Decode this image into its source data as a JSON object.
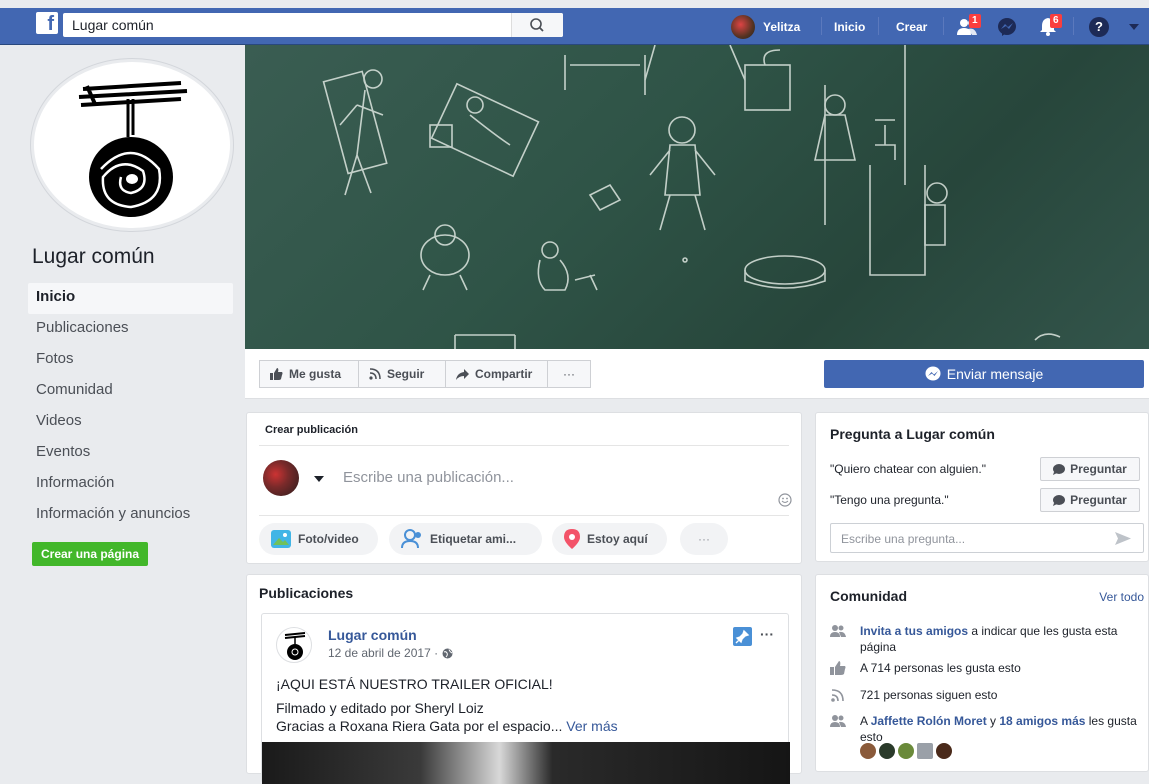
{
  "topbar": {
    "logo": "f",
    "search_value": "Lugar común",
    "user_name": "Yelitza",
    "home_label": "Inicio",
    "create_label": "Crear",
    "friend_requests_count": "1",
    "notifications_count": "6",
    "help_label": "?"
  },
  "page": {
    "name": "Lugar común"
  },
  "left_nav": {
    "items": [
      "Inicio",
      "Publicaciones",
      "Fotos",
      "Comunidad",
      "Videos",
      "Eventos",
      "Información",
      "Información y anuncios"
    ],
    "create_page_label": "Crear una página"
  },
  "actions": {
    "like": "Me gusta",
    "follow": "Seguir",
    "share": "Compartir",
    "more": "···",
    "message": "Enviar mensaje"
  },
  "composer": {
    "title": "Crear publicación",
    "placeholder": "Escribe una publicación...",
    "photo_video": "Foto/video",
    "tag_friends": "Etiquetar ami...",
    "checkin": "Estoy aquí",
    "more": "···"
  },
  "ask": {
    "title": "Pregunta a Lugar común",
    "q1": "\"Quiero chatear con alguien.\"",
    "q2": "\"Tengo una pregunta.\"",
    "ask_label": "Preguntar",
    "placeholder": "Escribe una pregunta..."
  },
  "posts": {
    "title": "Publicaciones",
    "post": {
      "author": "Lugar común",
      "date": "12 de abril de 2017 ·",
      "headline": "¡AQUI ESTÁ NUESTRO TRAILER OFICIAL!",
      "line2": "Filmado y editado por Sheryl Loiz",
      "line3": "Gracias a Roxana Riera Gata por el espacio...",
      "see_more": "Ver más",
      "menu": "···"
    }
  },
  "community": {
    "title": "Comunidad",
    "see_all": "Ver todo",
    "invite_link": "Invita a tus amigos",
    "invite_rest": " a indicar que les gusta esta página",
    "likes": "A 714 personas les gusta esto",
    "follows": "721 personas siguen esto",
    "friends_prefix": "A ",
    "friend_name": "Jaffette Rolón Moret",
    "friends_mid": " y ",
    "friends_more": "18 amigos más",
    "friends_suffix": " les gusta esto"
  },
  "colors": {
    "brand_blue": "#4267b2",
    "link_blue": "#365899",
    "green": "#42b72a",
    "badge_red": "#fa3e3e"
  }
}
